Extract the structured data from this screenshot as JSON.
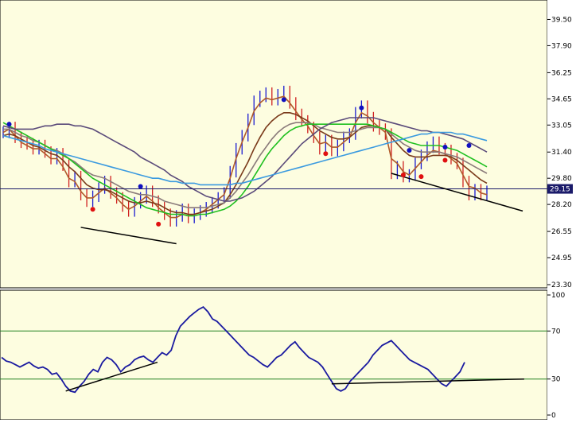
{
  "colors": {
    "background": "#fdfde0",
    "axis_bg": "#ffffff",
    "up_bar": "#1a1ad0",
    "down_bar": "#d02020",
    "ma_brown": "#b05a2a",
    "ma_dark_brown": "#7a3a1a",
    "ma_gray": "#8a7a7a",
    "ma_green": "#20c020",
    "ma_purple": "#5a4a7a",
    "ma_blue": "#3a9ae0",
    "rsi": "#1a1aa0",
    "level_line": "#208020",
    "price_line": "#1a1a6a",
    "trend_line": "#000000",
    "signal_up": "#1010c0",
    "signal_down": "#e01010"
  },
  "chart_data": [
    {
      "type": "line",
      "panel": "price",
      "y_ticks": [
        "39.50",
        "37.90",
        "36.25",
        "34.65",
        "33.05",
        "31.40",
        "29.80",
        "28.20",
        "26.55",
        "24.95",
        "23.30"
      ],
      "ylim": [
        23.3,
        40.3
      ],
      "current_price": {
        "value": 29.15,
        "label": "29.15"
      },
      "bars": [
        32.6,
        32.9,
        32.3,
        32.0,
        31.9,
        31.6,
        31.8,
        31.4,
        31.0,
        31.3,
        30.6,
        29.6,
        29.9,
        28.8,
        28.4,
        28.7,
        29.2,
        29.6,
        28.9,
        28.6,
        28.1,
        27.8,
        28.3,
        28.6,
        29.0,
        28.4,
        28.0,
        27.6,
        27.2,
        27.5,
        27.9,
        27.4,
        27.6,
        27.8,
        28.0,
        28.3,
        28.6,
        28.9,
        30.2,
        31.6,
        32.4,
        33.4,
        34.5,
        34.8,
        35.0,
        34.6,
        34.9,
        35.1,
        34.4,
        33.7,
        33.3,
        32.9,
        32.3,
        31.6,
        32.1,
        31.5,
        31.8,
        32.3,
        32.5,
        33.8,
        34.2,
        33.5,
        33.0,
        32.8,
        32.5,
        30.1,
        30.5,
        29.9,
        30.0,
        30.7,
        31.2,
        31.7,
        32.0,
        31.6,
        31.5,
        31.0,
        30.7,
        29.6,
        28.8,
        29.1,
        28.8,
        29.0
      ],
      "series": [
        {
          "color_key": "ma_brown",
          "values": [
            32.6,
            32.8,
            32.4,
            32.0,
            31.8,
            31.6,
            31.6,
            31.3,
            31.0,
            31.0,
            30.5,
            29.8,
            29.6,
            29.0,
            28.6,
            28.6,
            28.9,
            29.2,
            28.9,
            28.6,
            28.2,
            27.9,
            28.1,
            28.4,
            28.7,
            28.4,
            28.0,
            27.7,
            27.4,
            27.4,
            27.6,
            27.5,
            27.6,
            27.7,
            27.9,
            28.2,
            28.5,
            28.8,
            29.8,
            31.0,
            32.0,
            32.9,
            33.9,
            34.4,
            34.7,
            34.6,
            34.7,
            34.8,
            34.4,
            33.9,
            33.4,
            33.0,
            32.4,
            31.9,
            32.0,
            31.7,
            31.7,
            32.0,
            32.3,
            33.2,
            33.8,
            33.6,
            33.2,
            32.9,
            32.6,
            31.0,
            30.7,
            30.2,
            30.0,
            30.4,
            30.8,
            31.2,
            31.5,
            31.4,
            31.3,
            31.0,
            30.7,
            30.0,
            29.3,
            29.2,
            28.9,
            28.8
          ]
        },
        {
          "color_key": "ma_dark_brown",
          "values": [
            32.4,
            32.5,
            32.4,
            32.2,
            32.0,
            31.8,
            31.7,
            31.5,
            31.3,
            31.2,
            30.9,
            30.5,
            30.2,
            29.8,
            29.4,
            29.2,
            29.1,
            29.1,
            29.0,
            28.8,
            28.6,
            28.4,
            28.3,
            28.3,
            28.4,
            28.3,
            28.2,
            28.0,
            27.8,
            27.7,
            27.7,
            27.6,
            27.6,
            27.7,
            27.8,
            27.9,
            28.1,
            28.3,
            28.8,
            29.4,
            30.1,
            30.8,
            31.6,
            32.3,
            32.9,
            33.3,
            33.6,
            33.8,
            33.8,
            33.7,
            33.5,
            33.3,
            33.0,
            32.7,
            32.5,
            32.3,
            32.2,
            32.2,
            32.3,
            32.6,
            32.9,
            33.0,
            33.0,
            32.9,
            32.8,
            32.3,
            31.9,
            31.5,
            31.2,
            31.1,
            31.1,
            31.1,
            31.2,
            31.2,
            31.2,
            31.1,
            30.9,
            30.6,
            30.3,
            30.0,
            29.7,
            29.5
          ]
        },
        {
          "color_key": "ma_gray",
          "values": [
            32.8,
            32.8,
            32.6,
            32.4,
            32.3,
            32.1,
            32.0,
            31.8,
            31.6,
            31.5,
            31.3,
            31.0,
            30.8,
            30.5,
            30.2,
            30.0,
            29.9,
            29.8,
            29.6,
            29.4,
            29.2,
            29.0,
            28.9,
            28.8,
            28.8,
            28.7,
            28.6,
            28.4,
            28.3,
            28.2,
            28.1,
            28.0,
            28.0,
            28.0,
            28.0,
            28.1,
            28.2,
            28.3,
            28.6,
            29.0,
            29.5,
            30.0,
            30.6,
            31.2,
            31.7,
            32.2,
            32.6,
            32.9,
            33.1,
            33.2,
            33.2,
            33.2,
            33.1,
            32.9,
            32.8,
            32.7,
            32.6,
            32.6,
            32.6,
            32.7,
            32.8,
            32.9,
            32.9,
            32.9,
            32.8,
            32.5,
            32.2,
            31.9,
            31.7,
            31.5,
            31.4,
            31.4,
            31.4,
            31.4,
            31.3,
            31.2,
            31.1,
            30.9,
            30.7,
            30.5,
            30.3,
            30.1
          ]
        },
        {
          "color_key": "ma_green",
          "values": [
            33.2,
            33.0,
            32.8,
            32.6,
            32.4,
            32.2,
            32.0,
            31.8,
            31.6,
            31.4,
            31.2,
            31.0,
            30.7,
            30.4,
            30.1,
            29.8,
            29.6,
            29.4,
            29.2,
            29.0,
            28.8,
            28.6,
            28.4,
            28.2,
            28.0,
            27.9,
            27.8,
            27.7,
            27.6,
            27.6,
            27.6,
            27.5,
            27.5,
            27.6,
            27.6,
            27.7,
            27.8,
            27.9,
            28.1,
            28.4,
            28.8,
            29.3,
            29.9,
            30.5,
            31.1,
            31.6,
            32.0,
            32.4,
            32.7,
            32.9,
            33.0,
            33.1,
            33.1,
            33.1,
            33.1,
            33.1,
            33.1,
            33.1,
            33.1,
            33.1,
            33.1,
            33.1,
            33.0,
            32.9,
            32.8,
            32.6,
            32.4,
            32.2,
            32.0,
            31.9,
            31.8,
            31.8,
            31.8,
            31.8,
            31.7,
            31.6,
            31.5,
            31.3,
            31.1,
            30.9,
            30.7,
            30.5
          ]
        },
        {
          "color_key": "ma_purple",
          "values": [
            33.0,
            32.9,
            32.8,
            32.8,
            32.8,
            32.8,
            32.9,
            33.0,
            33.0,
            33.1,
            33.1,
            33.1,
            33.0,
            33.0,
            32.9,
            32.8,
            32.6,
            32.4,
            32.2,
            32.0,
            31.8,
            31.6,
            31.4,
            31.1,
            30.9,
            30.7,
            30.5,
            30.3,
            30.0,
            29.8,
            29.6,
            29.3,
            29.1,
            28.9,
            28.7,
            28.6,
            28.5,
            28.4,
            28.4,
            28.5,
            28.6,
            28.8,
            29.0,
            29.3,
            29.6,
            29.9,
            30.3,
            30.7,
            31.1,
            31.5,
            31.9,
            32.2,
            32.5,
            32.8,
            33.0,
            33.2,
            33.3,
            33.4,
            33.5,
            33.5,
            33.5,
            33.5,
            33.5,
            33.4,
            33.3,
            33.2,
            33.1,
            33.0,
            32.9,
            32.8,
            32.7,
            32.7,
            32.6,
            32.6,
            32.5,
            32.4,
            32.3,
            32.2,
            32.0,
            31.8,
            31.6,
            31.4
          ]
        },
        {
          "color_key": "ma_blue",
          "values": [
            32.4,
            32.3,
            32.2,
            32.1,
            32.0,
            31.9,
            31.8,
            31.6,
            31.5,
            31.4,
            31.3,
            31.2,
            31.1,
            31.0,
            30.9,
            30.8,
            30.7,
            30.6,
            30.5,
            30.4,
            30.3,
            30.2,
            30.1,
            30.0,
            29.9,
            29.8,
            29.8,
            29.7,
            29.6,
            29.6,
            29.5,
            29.5,
            29.5,
            29.4,
            29.4,
            29.4,
            29.4,
            29.4,
            29.4,
            29.5,
            29.5,
            29.6,
            29.7,
            29.8,
            29.9,
            30.0,
            30.1,
            30.2,
            30.3,
            30.4,
            30.5,
            30.6,
            30.7,
            30.8,
            30.9,
            31.0,
            31.1,
            31.2,
            31.3,
            31.4,
            31.5,
            31.6,
            31.7,
            31.8,
            31.9,
            32.0,
            32.1,
            32.2,
            32.3,
            32.4,
            32.5,
            32.5,
            32.6,
            32.6,
            32.6,
            32.6,
            32.5,
            32.5,
            32.4,
            32.3,
            32.2,
            32.1
          ]
        }
      ],
      "signals_up": [
        {
          "i": 1,
          "v": 33.1
        },
        {
          "i": 23,
          "v": 29.3
        },
        {
          "i": 47,
          "v": 34.6
        },
        {
          "i": 60,
          "v": 34.1
        },
        {
          "i": 68,
          "v": 31.5
        },
        {
          "i": 74,
          "v": 31.7
        },
        {
          "i": 78,
          "v": 31.8
        }
      ],
      "signals_down": [
        {
          "i": 15,
          "v": 27.9
        },
        {
          "i": 26,
          "v": 27.0
        },
        {
          "i": 54,
          "v": 31.3
        },
        {
          "i": 67,
          "v": 30.0
        },
        {
          "i": 70,
          "v": 29.9
        },
        {
          "i": 74,
          "v": 30.9
        }
      ],
      "trend_lines": [
        {
          "from": [
            13,
            26.8
          ],
          "to": [
            29,
            25.8
          ]
        },
        {
          "from": [
            65,
            30.1
          ],
          "to": [
            87,
            27.8
          ]
        }
      ]
    },
    {
      "type": "line",
      "panel": "oscillator",
      "y_ticks": [
        "100",
        "70",
        "30",
        "0"
      ],
      "ylim": [
        0,
        100
      ],
      "levels": [
        {
          "value": 70,
          "label": "70"
        },
        {
          "value": 30,
          "label": "30"
        }
      ],
      "values": [
        48,
        45,
        44,
        42,
        40,
        42,
        44,
        41,
        39,
        40,
        38,
        34,
        35,
        30,
        24,
        20,
        19,
        24,
        28,
        34,
        38,
        36,
        44,
        48,
        46,
        42,
        36,
        40,
        42,
        46,
        48,
        49,
        46,
        44,
        48,
        52,
        50,
        54,
        66,
        74,
        78,
        82,
        85,
        88,
        90,
        86,
        80,
        78,
        74,
        70,
        66,
        62,
        58,
        54,
        50,
        48,
        45,
        42,
        40,
        44,
        48,
        50,
        54,
        58,
        61,
        56,
        52,
        48,
        46,
        44,
        40,
        34,
        28,
        22,
        20,
        22,
        28,
        32,
        36,
        40,
        44,
        50,
        54,
        58,
        60,
        62,
        58,
        54,
        50,
        46,
        44,
        42,
        40,
        38,
        34,
        30,
        26,
        24,
        28,
        32,
        36,
        44
      ],
      "trend_lines": [
        {
          "from": [
            14,
            20
          ],
          "to": [
            34,
            44
          ]
        },
        {
          "from": [
            72,
            26
          ],
          "to": [
            114,
            30
          ]
        }
      ]
    }
  ]
}
